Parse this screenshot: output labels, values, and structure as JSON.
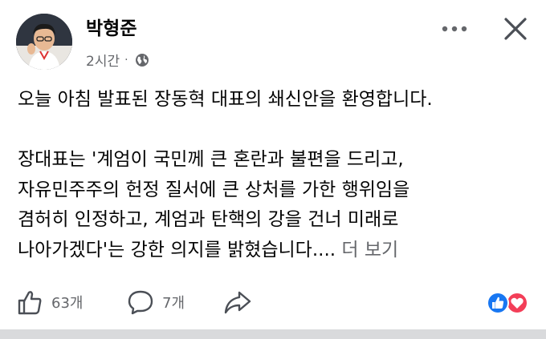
{
  "post": {
    "author": "박형준",
    "time": "2시간",
    "separator": "·",
    "lines": [
      "오늘 아침 발표된 장동혁 대표의 쇄신안을 환영합니다.",
      "장대표는 '계엄이 국민께 큰 혼란과 불편을 드리고,",
      "자유민주주의 헌정 질서에 큰 상처를 가한 행위임을",
      "겸허히 인정하고, 계엄과 탄핵의 강을 건너 미래로",
      "나아가겠다'는 강한 의지를 밝혔습니다.... "
    ],
    "see_more": "더 보기"
  },
  "actions": {
    "like_count": "63개",
    "comment_count": "7개"
  },
  "colors": {
    "text": "#050505",
    "muted": "#65676b",
    "like_blue": "#1877f2",
    "love_red": "#f33e58"
  },
  "icons": [
    "avatar",
    "globe-icon",
    "more-icon",
    "close-icon",
    "like-icon",
    "comment-icon",
    "share-icon",
    "like-reaction-icon",
    "love-reaction-icon"
  ]
}
